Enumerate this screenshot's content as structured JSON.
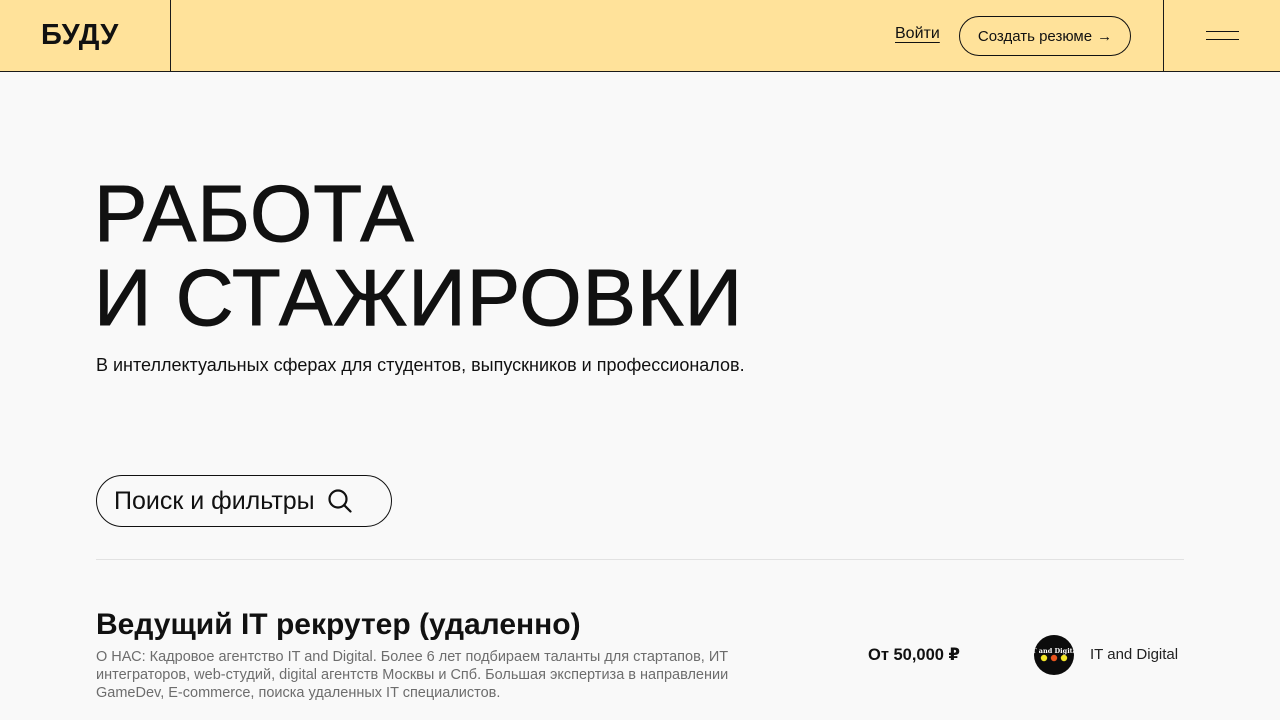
{
  "header": {
    "logo": "БУДУ",
    "login_label": "Войти",
    "create_resume_label": "Создать резюме",
    "create_resume_arrow": "→",
    "background_color": "#ffe29a"
  },
  "hero": {
    "title_line1": "РАБОТА",
    "title_line2": "И СТАЖИРОВКИ",
    "subtitle": "В интеллектуальных сферах для студентов, выпускников и профессионалов."
  },
  "search": {
    "label": "Поиск и фильтры",
    "icon": "search-icon"
  },
  "jobs": [
    {
      "title": "Ведущий IT рекрутер (удаленно)",
      "description": "О НАС: Кадровое агентство IT and Digital. Более 6 лет подбираем таланты для стартапов, ИТ интеграторов, web-студий, digital агентств Москвы и Спб. Большая экспертиза в направлении GameDev, E-commerce, поиска удаленных IT специалистов.",
      "salary": "От 50,000 ₽",
      "company": "IT and Digital",
      "logo_text": "IT and Digital"
    }
  ]
}
